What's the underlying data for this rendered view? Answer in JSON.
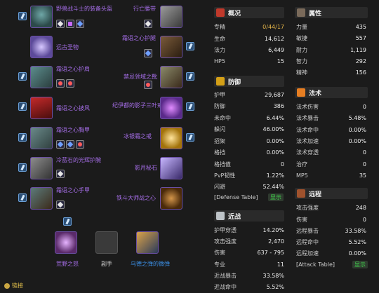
{
  "equipment": {
    "left": [
      {
        "name": "野兽战斗士的装备头盔"
      },
      {
        "name": "远古圣物"
      },
      {
        "name": "霜语之心护肩"
      },
      {
        "name": "霜语之心披风"
      },
      {
        "name": "霜语之心胸甲"
      },
      {
        "name": "冷蓝石的光辉护腕"
      },
      {
        "name": "霜语之心手甲"
      }
    ],
    "right": [
      {
        "name": "行亡腰带"
      },
      {
        "name": "霜语之心护腿"
      },
      {
        "name": "禁忌领域之靴"
      },
      {
        "name": "纪伊都的影子三叶戒"
      },
      {
        "name": "冰银霜之戒"
      },
      {
        "name": "影月秘石"
      },
      {
        "name": "铁斗大师战之心"
      }
    ],
    "weapons": [
      {
        "name": "荒野之怒"
      },
      {
        "name": "副手"
      },
      {
        "name": "乌德之弹的微弹"
      }
    ]
  },
  "sections": {
    "overview": {
      "title": "概况",
      "rows": [
        {
          "k": "专精",
          "v": "0/44/17"
        },
        {
          "k": "生命",
          "v": "14,612"
        },
        {
          "k": "法力",
          "v": "6,449"
        },
        {
          "k": "HP5",
          "v": "15"
        }
      ]
    },
    "attributes": {
      "title": "属性",
      "rows": [
        {
          "k": "力量",
          "v": "435"
        },
        {
          "k": "敏捷",
          "v": "557"
        },
        {
          "k": "耐力",
          "v": "1,119"
        },
        {
          "k": "智力",
          "v": "292"
        },
        {
          "k": "精神",
          "v": "156"
        }
      ]
    },
    "defense": {
      "title": "防御",
      "rows": [
        {
          "k": "护甲",
          "v": "29,687"
        },
        {
          "k": "防御",
          "v": "386"
        },
        {
          "k": "未命中",
          "v": "6.44%"
        },
        {
          "k": "躲闪",
          "v": "46.00%"
        },
        {
          "k": "招架",
          "v": "0.00%"
        },
        {
          "k": "格挡",
          "v": "0.00%"
        },
        {
          "k": "格挡值",
          "v": "0"
        },
        {
          "k": "PvP韧性",
          "v": "1.22%"
        },
        {
          "k": "闪避",
          "v": "52.44%"
        }
      ],
      "footer": "[Defense Table]",
      "show": "显示"
    },
    "spell": {
      "title": "法术",
      "rows": [
        {
          "k": "法术伤害",
          "v": "0"
        },
        {
          "k": "法术暴击",
          "v": "5.48%"
        },
        {
          "k": "法术命中",
          "v": "0.00%"
        },
        {
          "k": "法术加速",
          "v": "0.00%"
        },
        {
          "k": "法术穿透",
          "v": "0"
        },
        {
          "k": "治疗",
          "v": "0"
        },
        {
          "k": "MP5",
          "v": "35"
        }
      ]
    },
    "melee": {
      "title": "近战",
      "rows": [
        {
          "k": "护甲穿透",
          "v": "14.20%"
        },
        {
          "k": "攻击强度",
          "v": "2,470"
        },
        {
          "k": "伤害",
          "v": "637 - 795"
        },
        {
          "k": "专业",
          "v": "11"
        },
        {
          "k": "近战暴击",
          "v": "33.58%"
        },
        {
          "k": "近战命中",
          "v": "5.52%"
        }
      ]
    },
    "ranged": {
      "title": "远程",
      "rows": [
        {
          "k": "攻击强度",
          "v": "248"
        },
        {
          "k": "伤害",
          "v": "0"
        },
        {
          "k": "远程暴击",
          "v": "33.58%"
        },
        {
          "k": "远程命中",
          "v": "5.52%"
        },
        {
          "k": "远程加速",
          "v": "0.00%"
        }
      ],
      "footer": "[Attack Table]",
      "show": "显示"
    }
  },
  "footer": {
    "link": "链接"
  },
  "colors": {
    "epic": "#a66ee8",
    "rare": "#3b8fe6",
    "gold": "#e8b84a",
    "show": "#3fd14b"
  }
}
